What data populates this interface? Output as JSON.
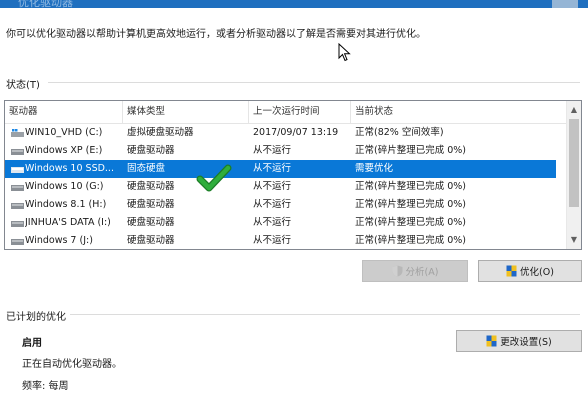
{
  "window": {
    "title": "优化驱动器"
  },
  "description": "你可以优化驱动器以帮助计算机更高效地运行，或者分析驱动器以了解是否需要对其进行优化。",
  "status_section": {
    "label": "状态(T)"
  },
  "drive_list": {
    "columns": [
      "驱动器",
      "媒体类型",
      "上一次运行时间",
      "当前状态"
    ],
    "rows": [
      {
        "drive": "WIN10_VHD (C:)",
        "media": "虚拟硬盘驱动器",
        "last_run": "2017/09/07 13:19",
        "status": "正常(82% 空间效率)",
        "icon": "windows-drive-icon"
      },
      {
        "drive": "Windows XP (E:)",
        "media": "硬盘驱动器",
        "last_run": "从不运行",
        "status": "正常(碎片整理已完成 0%)",
        "icon": "hard-drive-icon"
      },
      {
        "drive": "Windows 10 SSD...",
        "media": "固态硬盘",
        "last_run": "从不运行",
        "status": "需要优化",
        "icon": "hard-drive-icon",
        "selected": true
      },
      {
        "drive": "Windows 10 (G:)",
        "media": "硬盘驱动器",
        "last_run": "从不运行",
        "status": "正常(碎片整理已完成 0%)",
        "icon": "hard-drive-icon"
      },
      {
        "drive": "Windows 8.1 (H:)",
        "media": "硬盘驱动器",
        "last_run": "从不运行",
        "status": "正常(碎片整理已完成 0%)",
        "icon": "hard-drive-icon"
      },
      {
        "drive": "JINHUA'S DATA (I:)",
        "media": "硬盘驱动器",
        "last_run": "从不运行",
        "status": "正常(碎片整理已完成 0%)",
        "icon": "hard-drive-icon"
      },
      {
        "drive": "Windows 7 (J:)",
        "media": "硬盘驱动器",
        "last_run": "从不运行",
        "status": "正常(碎片整理已完成 0%)",
        "icon": "hard-drive-icon"
      }
    ]
  },
  "buttons": {
    "analyze": "分析(A)",
    "optimize": "优化(O)",
    "change_settings": "更改设置(S)"
  },
  "scheduled": {
    "section_label": "已计划的优化",
    "state": "启用",
    "info": "正在自动优化驱动器。",
    "frequency": "频率: 每周"
  },
  "colors": {
    "selection": "#0a78d7",
    "titlebar": "#1f6fbf",
    "checkmark": "#2fae3c"
  }
}
